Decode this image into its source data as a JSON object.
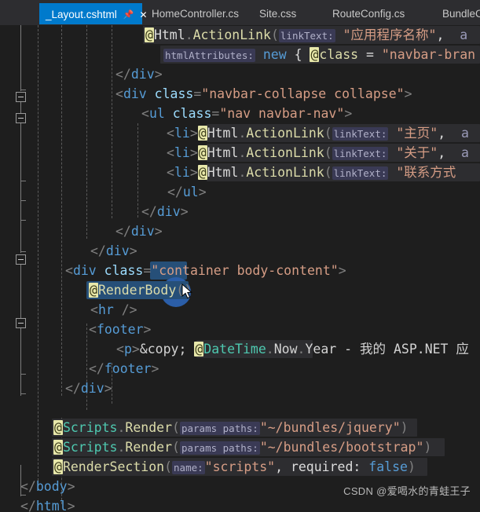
{
  "window": {
    "theme": "visual-studio-dark",
    "colors": {
      "editor_bg": "#1e1e1e",
      "tabstrip_bg": "#2d2d30",
      "active_tab": "#007acc",
      "selection": "#264f78",
      "string": "#d69d85",
      "tag": "#569cd6",
      "attribute": "#9cdcfe",
      "razor_method": "#dcdcaa",
      "type": "#4ec9b0"
    }
  },
  "tabs": [
    {
      "label": "_Layout.cshtml",
      "active": true,
      "pin_icon": "pin-icon",
      "close_icon": "close-icon"
    },
    {
      "label": "HomeController.cs",
      "active": false
    },
    {
      "label": "Site.css",
      "active": false
    },
    {
      "label": "RouteConfig.cs",
      "active": false
    },
    {
      "label": "BundleC",
      "active": false
    }
  ],
  "code": {
    "language": "cshtml",
    "lines": [
      "            @Html.ActionLink(linkText: \"应用程序名称\",  a",
      "                 htmlAttributes: new { @class = \"navbar-bran",
      "         </div>",
      "         <div class=\"navbar-collapse collapse\">",
      "             <ul class=\"nav navbar-nav\">",
      "                 <li>@Html.ActionLink(linkText: \"主页\",  a",
      "                 <li>@Html.ActionLink(linkText: \"关于\",  a",
      "                 <li>@Html.ActionLink(linkText: \"联系方式",
      "             </ul>",
      "         </div>",
      "      </div>",
      "   </div>",
      "   <div class=\"container body-content\">",
      "       @RenderBody()",
      "       <hr />",
      "       <footer>",
      "           <p>&copy; @DateTime.Now.Year - 我的 ASP.NET 应",
      "       </footer>",
      "   </div>",
      "",
      "   @Scripts.Render(params paths: \"~/bundles/jquery\")",
      "   @Scripts.Render(params paths: \"~/bundles/bootstrap\")",
      "   @RenderSection(name: \"scripts\", required: false)",
      "</body>",
      "</html>"
    ],
    "selected_text": "@RenderBody()",
    "named_parameter_hints": [
      "linkText:",
      "htmlAttributes:",
      "params paths:",
      "name:",
      "required:"
    ]
  },
  "watermark": {
    "text": "CSDN @爱喝水的青蛙王子"
  }
}
